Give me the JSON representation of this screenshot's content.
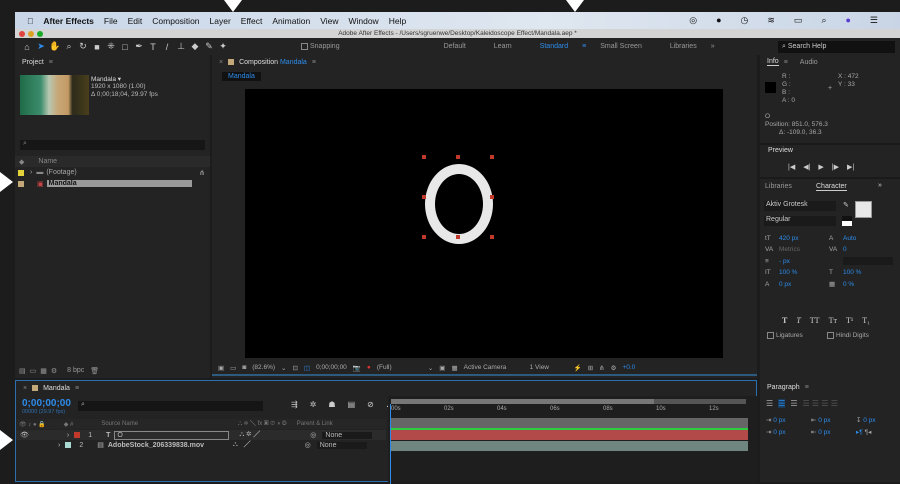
{
  "menubar": {
    "app": "After Effects",
    "items": [
      "File",
      "Edit",
      "Composition",
      "Layer",
      "Effect",
      "Animation",
      "View",
      "Window",
      "Help"
    ]
  },
  "window_title": "Adobe After Effects - /Users/sgruenwe/Desktop/Kaleidoscope Effect/Mandala.aep *",
  "toolbar": {
    "snapping": "Snapping",
    "workspaces": [
      "Default",
      "Learn",
      "Standard",
      "Small Screen",
      "Libraries"
    ],
    "active_workspace": "Standard",
    "search_placeholder": "Search Help"
  },
  "project": {
    "title": "Project",
    "comp_name": "Mandala ▾",
    "comp_res": "1920 x 1080 (1.00)",
    "comp_dur": "Δ 0;00;18;04, 29.97 fps",
    "col_name": "Name",
    "items": [
      {
        "name": "(Footage)",
        "color": "#e3d23a"
      },
      {
        "name": "Mandala",
        "color": "#c3a97a"
      }
    ],
    "bpc": "8 bpc"
  },
  "composition": {
    "panel_title": "Composition",
    "comp": "Mandala",
    "tab": "Mandala",
    "zoom": "(82.6%)",
    "timecode": "0;00;00;00",
    "resolution": "(Full)",
    "camera": "Active Camera",
    "views": "1 View",
    "exposure": "+0.0"
  },
  "info": {
    "tab": "Info",
    "tab2": "Audio",
    "r": "R :",
    "g": "G :",
    "b": "B :",
    "a": "A : 0",
    "x": "X : 472",
    "y": "Y : 33",
    "layer": "O",
    "position": "Position: 851.0, 576.3",
    "delta": "Δ: -109.0, 36.3"
  },
  "preview": {
    "title": "Preview"
  },
  "character": {
    "tab1": "Libraries",
    "tab2": "Character",
    "font": "Aktiv Grotesk",
    "style": "Regular",
    "size": "420 px",
    "leading": "Auto",
    "kerning": "Metrics",
    "tracking": "0",
    "stroke": "- px",
    "vscale": "100 %",
    "hscale": "100 %",
    "baseline": "0 px",
    "tsume": "0 %",
    "ligatures": "Ligatures",
    "hindi": "Hindi Digits"
  },
  "paragraph": {
    "title": "Paragraph",
    "values": [
      "0 px",
      "0 px",
      "0 px",
      "0 px",
      "0 px"
    ]
  },
  "timeline": {
    "tab": "Mandala",
    "timecode": "0;00;00;00",
    "fps": "00000 (29.97 fps)",
    "col_source": "Source Name",
    "col_parent": "Parent & Link",
    "ticks": [
      "00s",
      "02s",
      "04s",
      "06s",
      "08s",
      "10s",
      "12s"
    ],
    "layers": [
      {
        "num": "1",
        "name": "O",
        "color": "#c0392b",
        "parent": "None"
      },
      {
        "num": "2",
        "name": "AdobeStock_206339838.mov",
        "color": "#a8d8d0",
        "parent": "None"
      }
    ]
  }
}
